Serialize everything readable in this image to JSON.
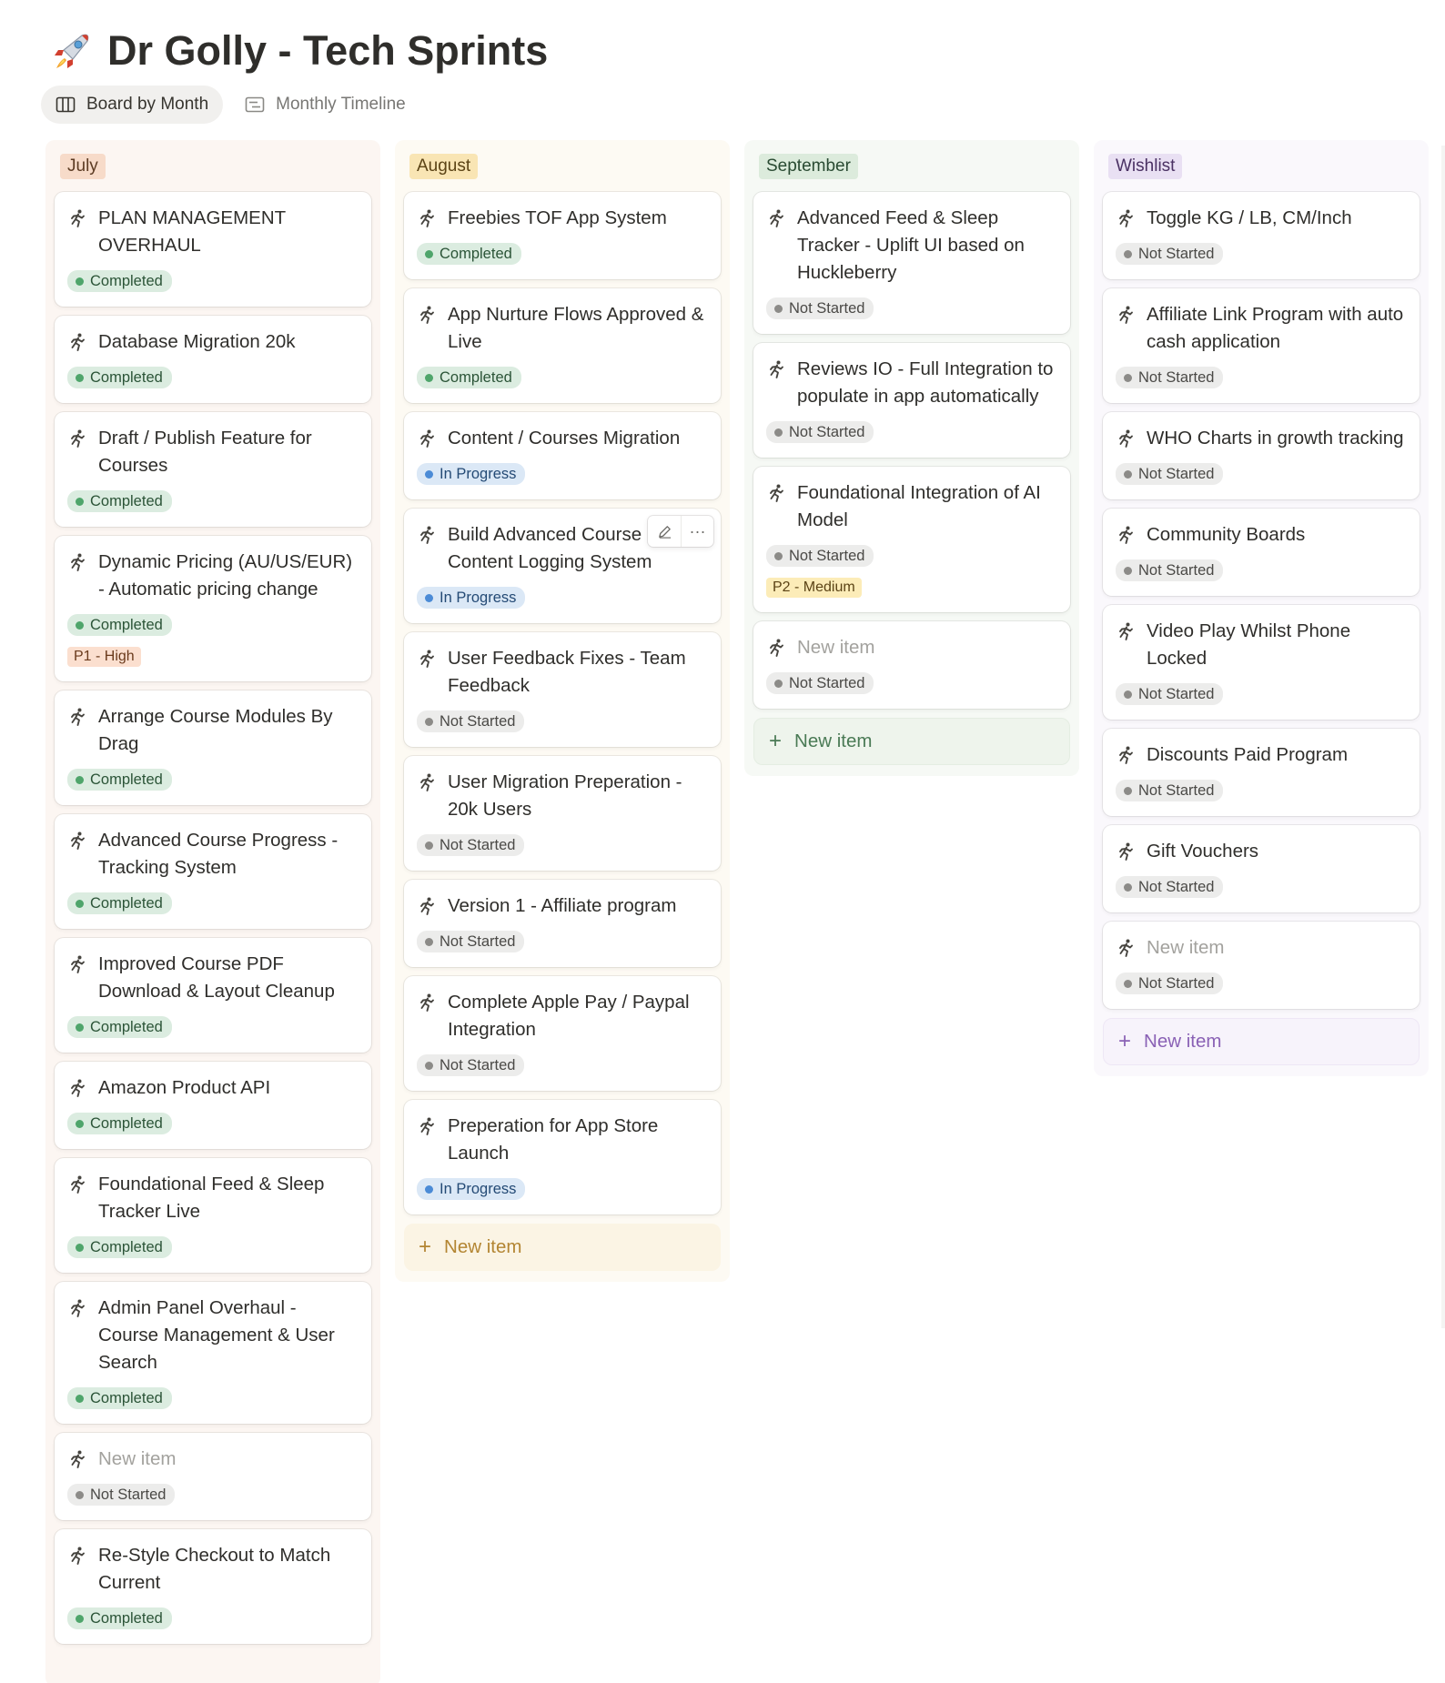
{
  "page": {
    "title": "Dr Golly - Tech Sprints",
    "icon": "rocket-icon"
  },
  "views": [
    {
      "label": "Board by Month",
      "icon": "board-icon",
      "active": true
    },
    {
      "label": "Monthly Timeline",
      "icon": "timeline-icon",
      "active": false
    }
  ],
  "colors": {
    "completed": "#4fa56b",
    "in_progress": "#4b8bd6",
    "not_started": "#8c8b88"
  },
  "columns": {
    "july": {
      "label": "July",
      "cards": [
        {
          "title": "PLAN MANAGEMENT OVERHAUL",
          "status": "Completed"
        },
        {
          "title": "Database Migration 20k",
          "status": "Completed"
        },
        {
          "title": "Draft / Publish Feature for Courses",
          "status": "Completed"
        },
        {
          "title": "Dynamic Pricing (AU/US/EUR) - Automatic pricing change",
          "status": "Completed",
          "priority": "P1 - High"
        },
        {
          "title": "Arrange Course Modules By Drag",
          "status": "Completed"
        },
        {
          "title": "Advanced Course Progress - Tracking System",
          "status": "Completed"
        },
        {
          "title": "Improved Course PDF Download & Layout Cleanup",
          "status": "Completed"
        },
        {
          "title": "Amazon Product API",
          "status": "Completed"
        },
        {
          "title": "Foundational Feed & Sleep Tracker Live",
          "status": "Completed"
        },
        {
          "title": "Admin Panel Overhaul - Course Management & User Search",
          "status": "Completed"
        },
        {
          "title": "New item",
          "status": "Not Started"
        },
        {
          "title": "Re-Style Checkout to Match Current",
          "status": "Completed"
        }
      ]
    },
    "august": {
      "label": "August",
      "new_item": "New item",
      "cards": [
        {
          "title": "Freebies TOF App System",
          "status": "Completed"
        },
        {
          "title": "App Nurture Flows Approved & Live",
          "status": "Completed"
        },
        {
          "title": "Content / Courses Migration",
          "status": "In Progress"
        },
        {
          "title": "Build Advanced Course Content Logging System",
          "status": "In Progress"
        },
        {
          "title": "User Feedback Fixes - Team Feedback",
          "status": "Not Started"
        },
        {
          "title": "User Migration Preperation - 20k Users",
          "status": "Not Started"
        },
        {
          "title": "Version 1 - Affiliate program",
          "status": "Not Started"
        },
        {
          "title": "Complete Apple Pay / Paypal Integration",
          "status": "Not Started"
        },
        {
          "title": "Preperation for App Store Launch",
          "status": "In Progress"
        }
      ]
    },
    "september": {
      "label": "September",
      "new_item": "New item",
      "cards": [
        {
          "title": "Advanced Feed & Sleep Tracker - Uplift UI based on Huckleberry",
          "status": "Not Started"
        },
        {
          "title": "Reviews IO - Full Integration to populate in app automatically",
          "status": "Not Started"
        },
        {
          "title": "Foundational Integration of AI Model",
          "status": "Not Started",
          "priority": "P2 - Medium"
        },
        {
          "title": "New item",
          "status": "Not Started"
        }
      ]
    },
    "wishlist": {
      "label": "Wishlist",
      "new_item": "New item",
      "cards": [
        {
          "title": "Toggle KG / LB, CM/Inch",
          "status": "Not Started"
        },
        {
          "title": "Affiliate Link Program with auto cash application",
          "status": "Not Started"
        },
        {
          "title": "WHO Charts in growth tracking",
          "status": "Not Started"
        },
        {
          "title": "Community Boards",
          "status": "Not Started"
        },
        {
          "title": "Video Play Whilst Phone Locked",
          "status": "Not Started"
        },
        {
          "title": "Discounts Paid Program",
          "status": "Not Started"
        },
        {
          "title": "Gift Vouchers",
          "status": "Not Started"
        },
        {
          "title": "New item",
          "status": "Not Started"
        }
      ]
    }
  }
}
